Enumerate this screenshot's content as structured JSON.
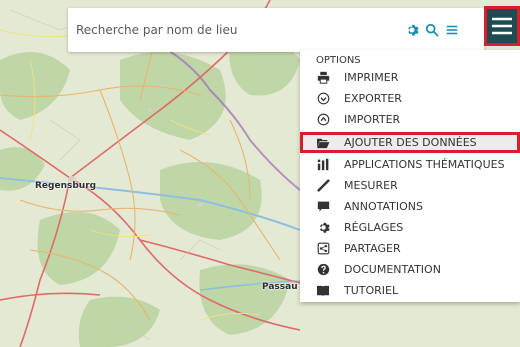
{
  "search": {
    "placeholder": "Recherche par nom de lieu"
  },
  "map": {
    "labels": {
      "regensburg": "Regensburg",
      "passau": "Passau"
    }
  },
  "menu": {
    "title": "OPTIONS",
    "items": [
      {
        "label": "IMPRIMER",
        "icon": "print-icon"
      },
      {
        "label": "EXPORTER",
        "icon": "export-icon"
      },
      {
        "label": "IMPORTER",
        "icon": "import-icon"
      },
      {
        "label": "AJOUTER DES DONNÉES",
        "icon": "folder-open-icon",
        "highlighted": true
      },
      {
        "label": "APPLICATIONS THÉMATIQUES",
        "icon": "thematic-apps-icon"
      },
      {
        "label": "MESURER",
        "icon": "ruler-icon"
      },
      {
        "label": "ANNOTATIONS",
        "icon": "comment-icon"
      },
      {
        "label": "RÉGLAGES",
        "icon": "settings-icon"
      },
      {
        "label": "PARTAGER",
        "icon": "share-icon"
      },
      {
        "label": "DOCUMENTATION",
        "icon": "help-icon"
      },
      {
        "label": "TUTORIEL",
        "icon": "book-icon"
      }
    ]
  },
  "colors": {
    "accent": "#1a8fb0",
    "menu_button": "#1f4b52",
    "highlight_border": "#d71f2c"
  }
}
